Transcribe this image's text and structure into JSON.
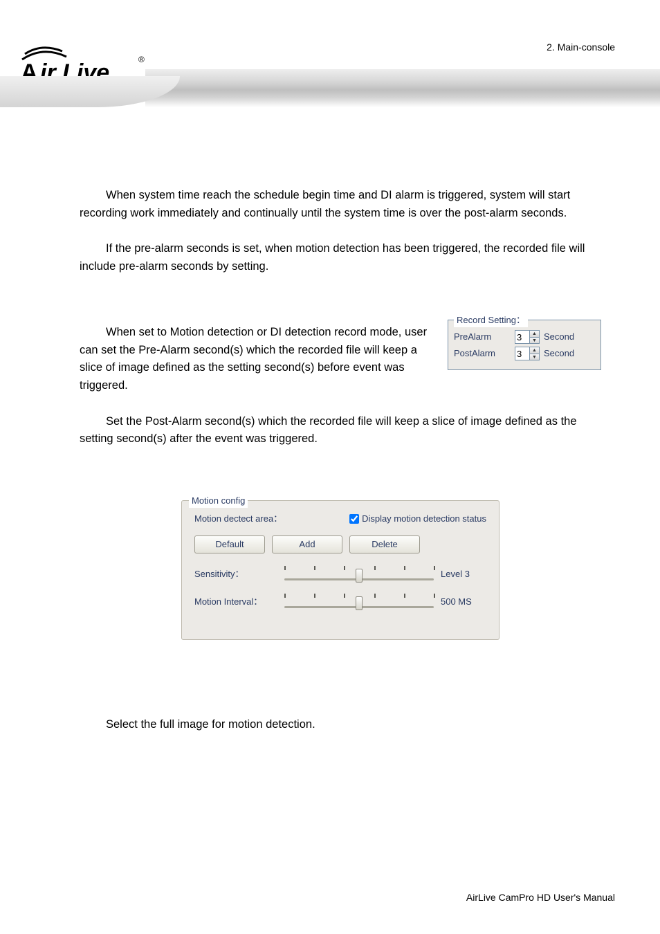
{
  "header": {
    "breadcrumb": "2. Main-console",
    "logo_main": "ir Live",
    "logo_reg": "®"
  },
  "paragraphs": {
    "p1": "When system time reach the schedule begin time and DI alarm is triggered, system will start recording work immediately and continually until the system time is over the post-alarm seconds.",
    "p2": "If the pre-alarm seconds is set, when motion detection has been triggered, the recorded file will include pre-alarm seconds by setting.",
    "p3": "When set to Motion detection or DI detection record mode, user can set the Pre-Alarm second(s) which the recorded file will keep a slice of image defined as the setting second(s) before event was triggered.",
    "p4": "Set the Post-Alarm second(s) which the recorded file will keep a slice of image defined as the setting second(s) after the event was triggered.",
    "p5": "Select the full image for motion detection."
  },
  "record_setting": {
    "legend": "Record Setting：",
    "rows": [
      {
        "label": "PreAlarm",
        "value": "3",
        "unit": "Second"
      },
      {
        "label": "PostAlarm",
        "value": "3",
        "unit": "Second"
      }
    ]
  },
  "motion_config": {
    "legend": "Motion config",
    "area_label": "Motion dectect area：",
    "checkbox_label": "Display motion detection status",
    "checkbox_checked": true,
    "buttons": {
      "default": "Default",
      "add": "Add",
      "delete": "Delete"
    },
    "sliders": [
      {
        "label": "Sensitivity：",
        "value_text": "Level 3",
        "pos_pct": 50,
        "ticks": [
          0,
          20,
          40,
          60,
          80,
          100
        ]
      },
      {
        "label": "Motion Interval：",
        "value_text": "500 MS",
        "pos_pct": 50,
        "ticks": [
          0,
          20,
          40,
          60,
          80,
          100
        ]
      }
    ]
  },
  "footer": {
    "text": "AirLive CamPro HD User's Manual"
  }
}
